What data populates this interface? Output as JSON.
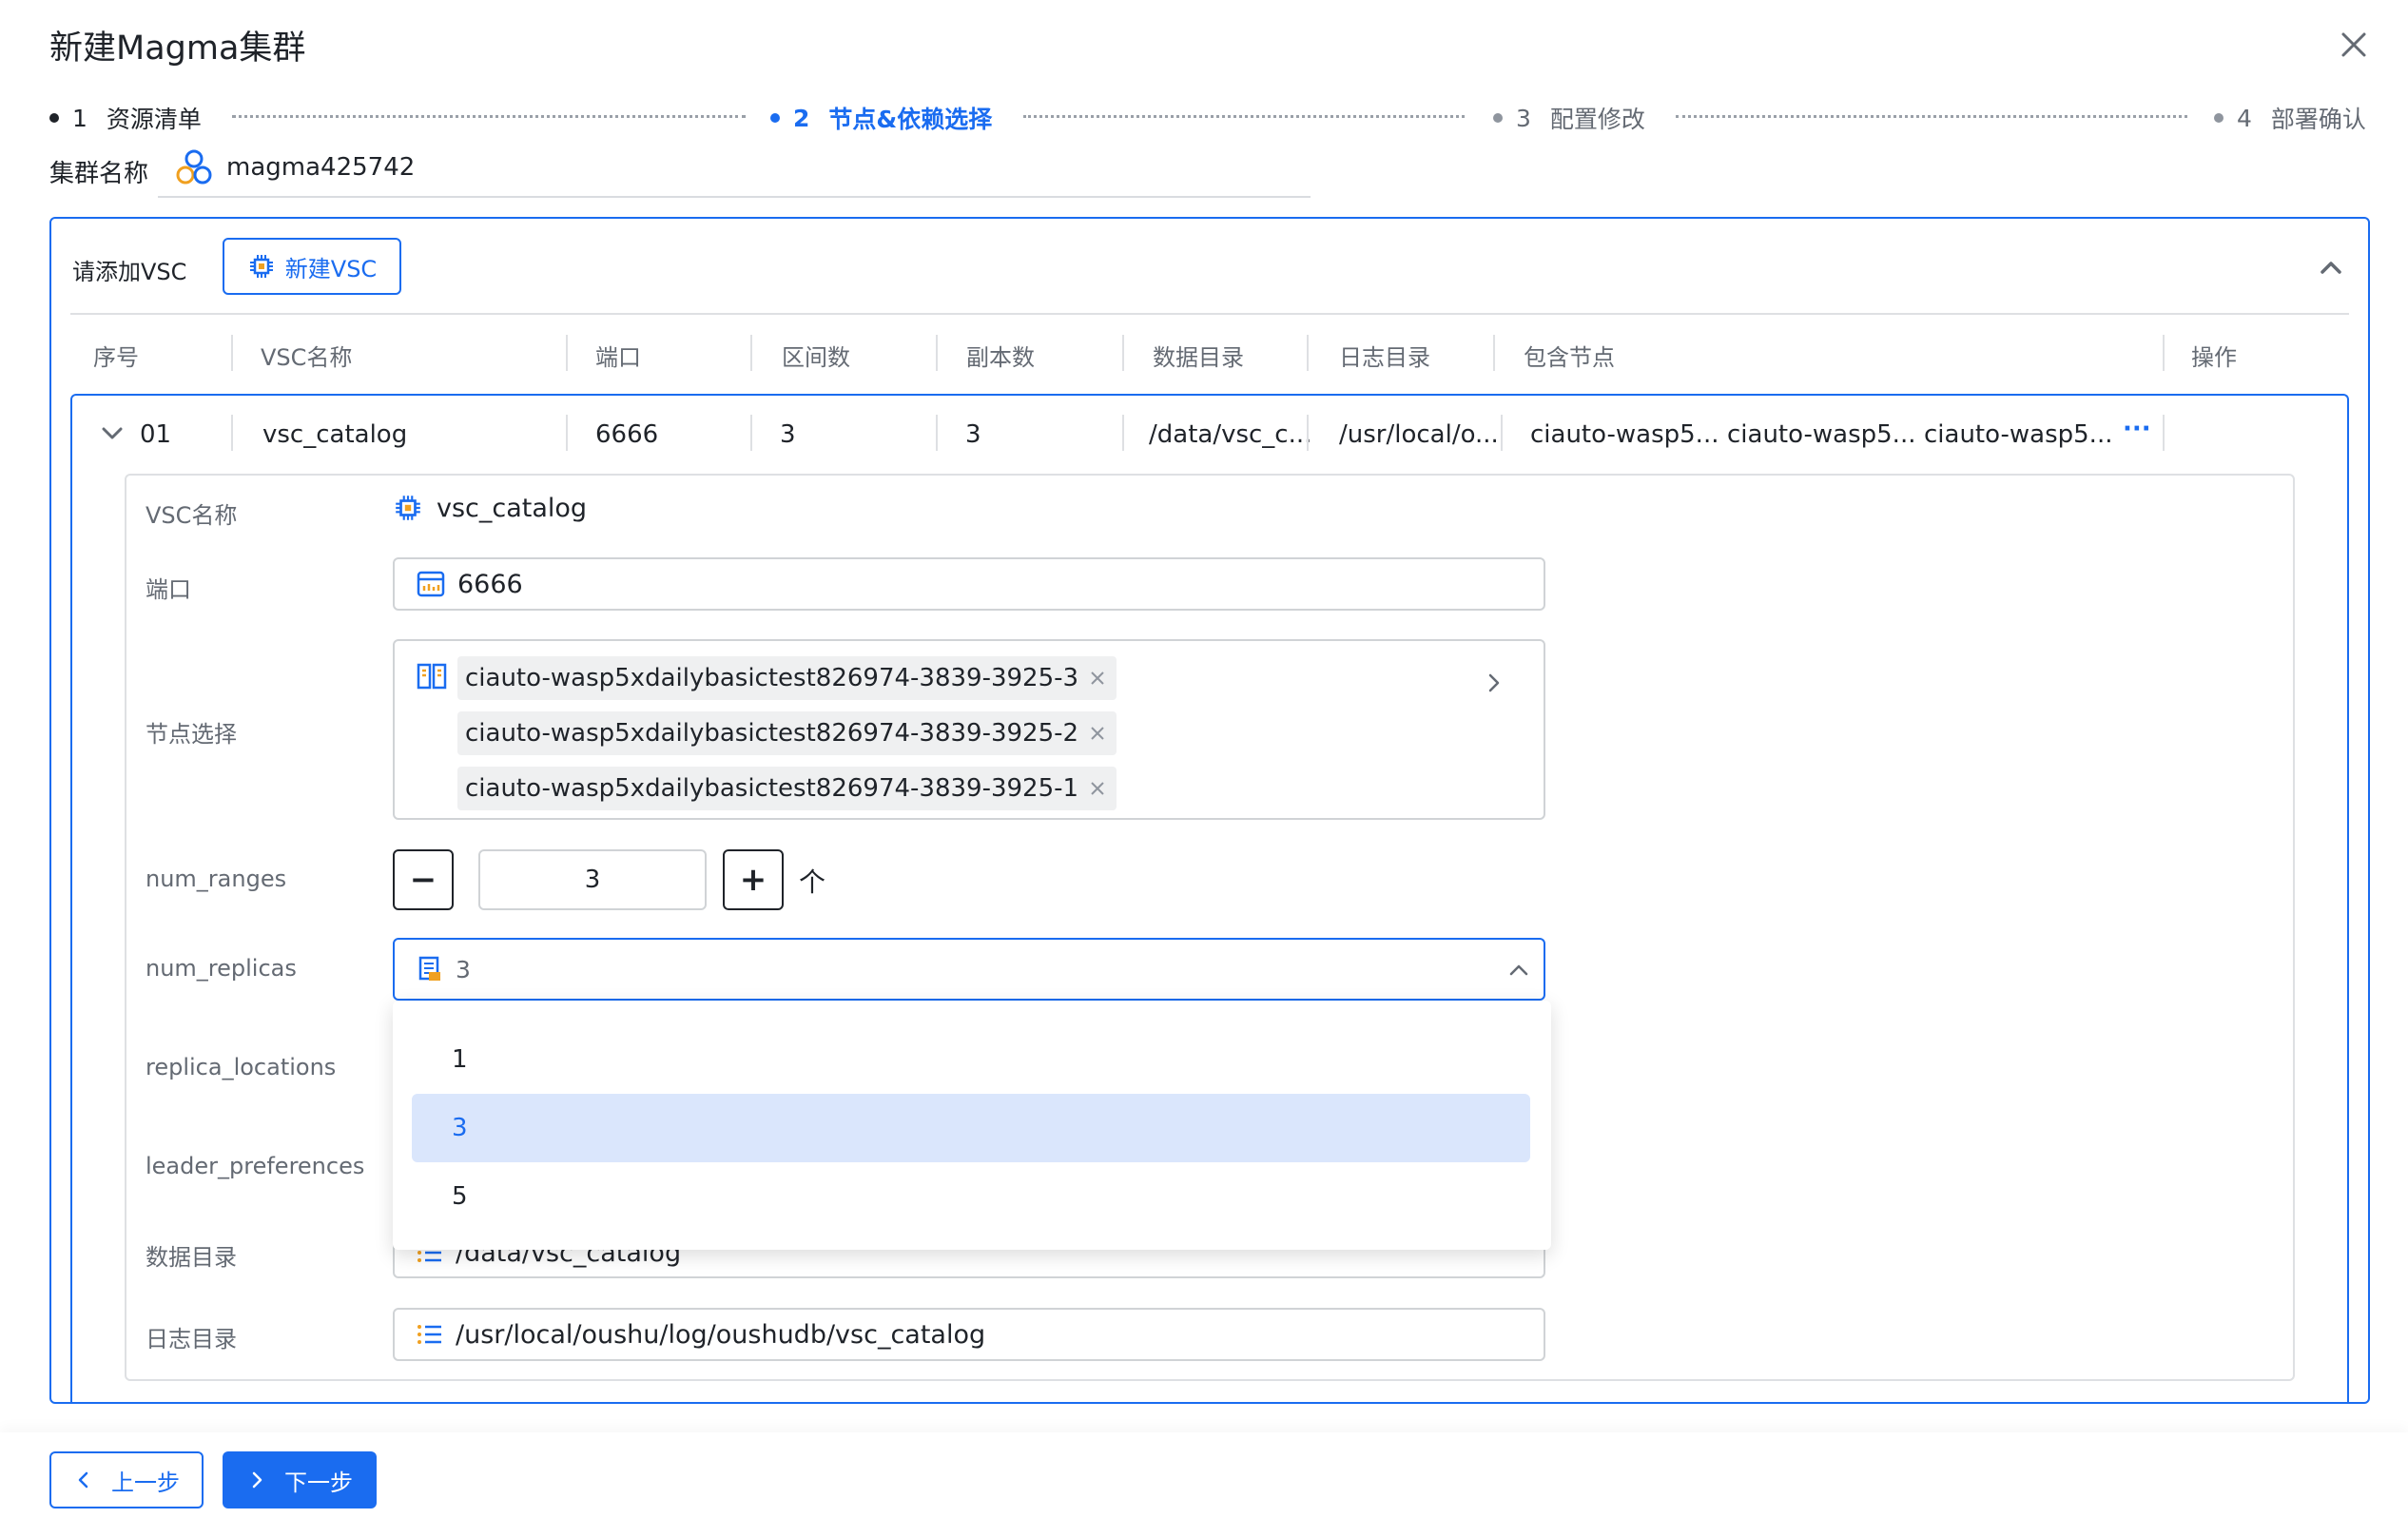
{
  "dialog": {
    "title": "新建Magma集群"
  },
  "steps": [
    {
      "num": "1",
      "label": "资源清单"
    },
    {
      "num": "2",
      "label": "节点&依赖选择"
    },
    {
      "num": "3",
      "label": "配置修改"
    },
    {
      "num": "4",
      "label": "部署确认"
    }
  ],
  "cluster": {
    "label": "集群名称",
    "name": "magma425742"
  },
  "vsc_panel": {
    "add_label": "请添加VSC",
    "new_button": "新建VSC",
    "columns": [
      "序号",
      "VSC名称",
      "端口",
      "区间数",
      "副本数",
      "数据目录",
      "日志目录",
      "包含节点",
      "操作"
    ],
    "row": {
      "index": "01",
      "name": "vsc_catalog",
      "port": "6666",
      "ranges": "3",
      "replicas": "3",
      "data_dir": "/data/vsc_c...",
      "log_dir": "/usr/local/o...",
      "nodes": [
        "ciauto-wasp5...",
        "ciauto-wasp5...",
        "ciauto-wasp5..."
      ],
      "more": "···"
    }
  },
  "form": {
    "vsc_name_label": "VSC名称",
    "vsc_name": "vsc_catalog",
    "port_label": "端口",
    "port": "6666",
    "nodes_label": "节点选择",
    "nodes": [
      "ciauto-wasp5xdailybasictest826974-3839-3925-3",
      "ciauto-wasp5xdailybasictest826974-3839-3925-2",
      "ciauto-wasp5xdailybasictest826974-3839-3925-1"
    ],
    "num_ranges_label": "num_ranges",
    "num_ranges": "3",
    "num_ranges_unit": "个",
    "minus": "−",
    "plus": "+",
    "num_replicas_label": "num_replicas",
    "num_replicas": "3",
    "replica_options": [
      "1",
      "3",
      "5"
    ],
    "replica_locations_label": "replica_locations",
    "leader_preferences_label": "leader_preferences",
    "data_dir_label": "数据目录",
    "data_dir": "/data/vsc_catalog",
    "log_dir_label": "日志目录",
    "log_dir": "/usr/local/oushu/log/oushudb/vsc_catalog"
  },
  "footer": {
    "prev": "上一步",
    "next": "下一步"
  },
  "colors": {
    "primary": "#1a6cf0",
    "selected_bg": "#dae6fc",
    "border": "#d0d3d6"
  },
  "icons": [
    "close-icon",
    "cluster-icon",
    "chip-icon",
    "chevron-up-icon",
    "chevron-down-icon",
    "port-icon",
    "nodes-icon",
    "chevron-right-icon",
    "doc-icon",
    "list-icon",
    "chevron-left-icon"
  ]
}
